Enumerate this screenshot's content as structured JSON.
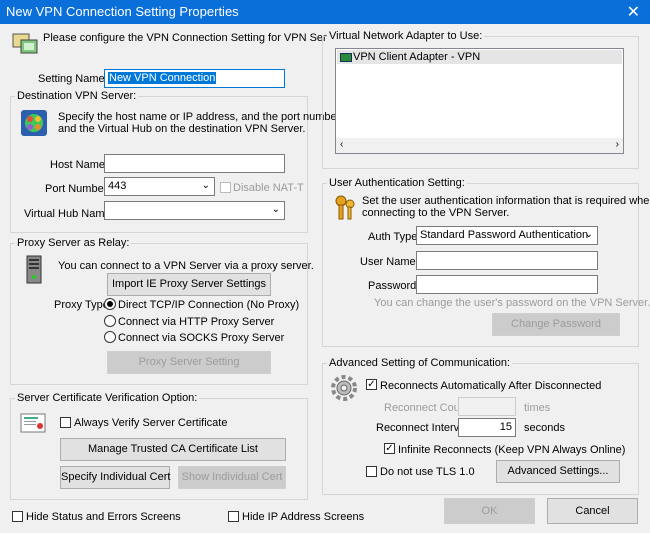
{
  "window": {
    "title": "New VPN Connection Setting Properties",
    "close_glyph": "✕"
  },
  "intro": {
    "text": "Please configure the VPN Connection Setting for VPN Server."
  },
  "setting_name": {
    "label": "Setting Name:",
    "value": "New VPN Connection"
  },
  "destination": {
    "group_label": "Destination VPN Server:",
    "description_line1": "Specify the host name or IP address, and the port number",
    "description_line2": "and the Virtual Hub on the destination VPN Server.",
    "host_label": "Host Name:",
    "host_value": "",
    "port_label": "Port Number:",
    "port_value": "443",
    "disable_nat_label": "Disable NAT-T",
    "hub_label": "Virtual Hub Name:",
    "hub_value": ""
  },
  "proxy": {
    "group_label": "Proxy Server as Relay:",
    "description": "You can connect to a VPN Server via a proxy server.",
    "import_button": "Import IE Proxy Server Settings",
    "type_label": "Proxy Type:",
    "options": [
      "Direct TCP/IP Connection (No Proxy)",
      "Connect via HTTP Proxy Server",
      "Connect via SOCKS Proxy Server"
    ],
    "selected": 0,
    "setting_button": "Proxy Server Setting"
  },
  "certificate": {
    "group_label": "Server Certificate Verification Option:",
    "always_verify_label": "Always Verify Server Certificate",
    "manage_button": "Manage Trusted CA Certificate List",
    "specify_button": "Specify Individual Cert",
    "show_button": "Show Individual Cert"
  },
  "adapter": {
    "group_label": "Virtual Network Adapter to Use:",
    "items": [
      "VPN Client Adapter - VPN"
    ]
  },
  "auth": {
    "group_label": "User Authentication Setting:",
    "description_line1": "Set the user authentication information that is required when",
    "description_line2": "connecting to the VPN Server.",
    "type_label": "Auth Type:",
    "type_value": "Standard Password Authentication",
    "user_label": "User Name:",
    "user_value": "",
    "password_label": "Password:",
    "password_value": "",
    "hint": "You can change the user's password on the VPN Server.",
    "change_button": "Change Password"
  },
  "advanced": {
    "group_label": "Advanced Setting of Communication:",
    "reconnect_label": "Reconnects Automatically After Disconnected",
    "count_label": "Reconnect Count:",
    "count_value": "",
    "count_unit": "times",
    "interval_label": "Reconnect Interval:",
    "interval_value": "15",
    "interval_unit": "seconds",
    "infinite_label": "Infinite Reconnects (Keep VPN Always Online)",
    "no_tls_label": "Do not use TLS 1.0",
    "settings_button": "Advanced Settings..."
  },
  "footer": {
    "hide_status_label": "Hide Status and Errors Screens",
    "hide_ip_label": "Hide IP Address Screens",
    "ok_button": "OK",
    "cancel_button": "Cancel"
  }
}
